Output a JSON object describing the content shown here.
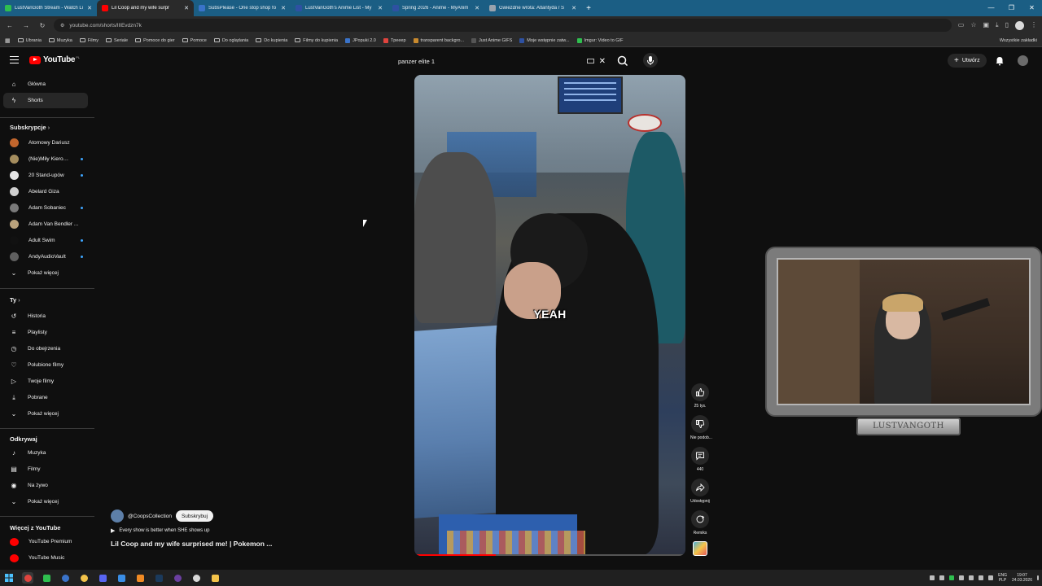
{
  "browser": {
    "tabs": [
      {
        "label": "LustVanGoth Stream - Watch Li",
        "color": "#2fbf4f",
        "active": false
      },
      {
        "label": "Lil Coop and my wife surpr",
        "color": "#ff0000",
        "active": true
      },
      {
        "label": "SubsPlease - One stop shop fo",
        "color": "#3a73c9",
        "active": false
      },
      {
        "label": "LustVanGoth's Anime List - My",
        "color": "#2e51a2",
        "active": false
      },
      {
        "label": "Spring 2026 - Anime - MyAnim",
        "color": "#2e51a2",
        "active": false
      },
      {
        "label": "Gwiezdne wrota: Atlantyda / S",
        "color": "#9aa3ad",
        "active": false
      }
    ],
    "new_tab": "+",
    "url": "youtube.com/shorts/lIIEvdzn7k",
    "bookmarks": [
      "Ubrania",
      "Muzyka",
      "Filmy",
      "Seriale",
      "Pomoce do gier",
      "Pomoce",
      "Do oglądania",
      "Do kupienia",
      "Filmy do kupienia",
      "JPopuki 2.0",
      "Tpeeep",
      "transparent backgro...",
      "Just Anime GIFS",
      "Moje wstępnie zatw...",
      "Imgur: Video to GIF"
    ],
    "bookmarks_all": "Wszystkie zakładki"
  },
  "youtube": {
    "logo_text": "YouTube",
    "region": "PL",
    "search_value": "panzer elite 1",
    "create_label": "Utwórz"
  },
  "sidebar": {
    "main": [
      {
        "label": "Główna",
        "icon": "home-icon"
      },
      {
        "label": "Shorts",
        "icon": "shorts-icon",
        "active": true
      }
    ],
    "subs_header": "Subskrypcje",
    "subs": [
      {
        "label": "Atomowy Dariusz",
        "color": "#c2662d",
        "live": false
      },
      {
        "label": "(Nie)Miły Kierow...",
        "color": "#a58d5e",
        "live": true
      },
      {
        "label": "20 Stand-upów",
        "color": "#e4e4e4",
        "live": true
      },
      {
        "label": "Abelard Giza",
        "color": "#d0d0d0",
        "live": false
      },
      {
        "label": "Adam Sobaniec",
        "color": "#7a7a7a",
        "live": true
      },
      {
        "label": "Adam Van Bendler ...",
        "color": "#b9a27c",
        "live": false
      },
      {
        "label": "Adult Swim",
        "color": "#111111",
        "live": true
      },
      {
        "label": "AndyAudioVault",
        "color": "#5f5f5f",
        "live": true
      }
    ],
    "subs_more": "Pokaż więcej",
    "you_header": "Ty",
    "you": [
      {
        "label": "Historia",
        "icon": "history-icon"
      },
      {
        "label": "Playlisty",
        "icon": "playlist-icon"
      },
      {
        "label": "Do obejrzenia",
        "icon": "clock-icon"
      },
      {
        "label": "Polubione filmy",
        "icon": "like-icon"
      },
      {
        "label": "Twoje filmy",
        "icon": "video-icon"
      },
      {
        "label": "Pobrane",
        "icon": "download-icon"
      },
      {
        "label": "Pokaż więcej",
        "icon": "chevron-down-icon"
      }
    ],
    "explore_header": "Odkrywaj",
    "explore": [
      {
        "label": "Muzyka",
        "icon": "music-icon"
      },
      {
        "label": "Filmy",
        "icon": "film-icon"
      },
      {
        "label": "Na żywo",
        "icon": "live-icon"
      },
      {
        "label": "Pokaż więcej",
        "icon": "chevron-down-icon"
      }
    ],
    "more_header": "Więcej z YouTube",
    "more": [
      {
        "label": "YouTube Premium",
        "color": "#ff0000"
      },
      {
        "label": "YouTube Music",
        "color": "#ff0000"
      }
    ]
  },
  "short": {
    "caption": "YEAH",
    "progress": 0.3,
    "channel": "@CoopsCollection",
    "subscribe_label": "Subskrybuj",
    "song": "Every show is better when SHE shows up",
    "title": "Lil Coop and my wife surprised me! | Pokemon ..."
  },
  "actions": [
    {
      "name": "like",
      "label": "25 tys."
    },
    {
      "name": "dislike",
      "label": "Nie podob..."
    },
    {
      "name": "comments",
      "label": "440"
    },
    {
      "name": "share",
      "label": "Udostępnij"
    },
    {
      "name": "remix",
      "label": "Remiks"
    }
  ],
  "overlay": {
    "nameplate": "LUSTVANGOTH"
  },
  "taskbar": {
    "lang_top": "ENG",
    "lang_bottom": "PLP",
    "time": "19:07",
    "date": "24.03.2026"
  }
}
